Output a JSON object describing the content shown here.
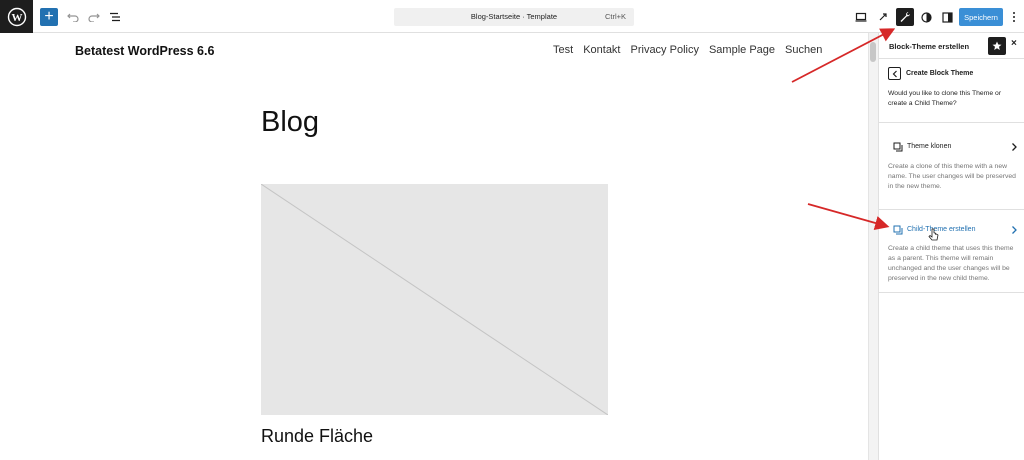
{
  "toolbar": {
    "document_title": "Blog-Startseite · Template",
    "shortcut": "Ctrl+K",
    "save_label": "Speichern"
  },
  "canvas": {
    "site_title": "Betatest WordPress 6.6",
    "nav": [
      "Test",
      "Kontakt",
      "Privacy Policy",
      "Sample Page",
      "Suchen"
    ],
    "page_heading": "Blog",
    "post_title": "Runde Fläche"
  },
  "sidebar": {
    "title": "Block-Theme erstellen",
    "panel_title": "Create Block Theme",
    "intro": "Would you like to clone this Theme or create a Child Theme?",
    "options": [
      {
        "label": "Theme klonen",
        "description": "Create a clone of this theme with a new name. The user changes will be preserved in the new theme."
      },
      {
        "label": "Child-Theme erstellen",
        "description": "Create a child theme that uses this theme as a parent. This theme will remain unchanged and the user changes will be preserved in the new child theme."
      }
    ]
  },
  "colors": {
    "accent": "#2271b1",
    "annotation_arrow": "#d62828",
    "dark": "#1e1e1e"
  }
}
